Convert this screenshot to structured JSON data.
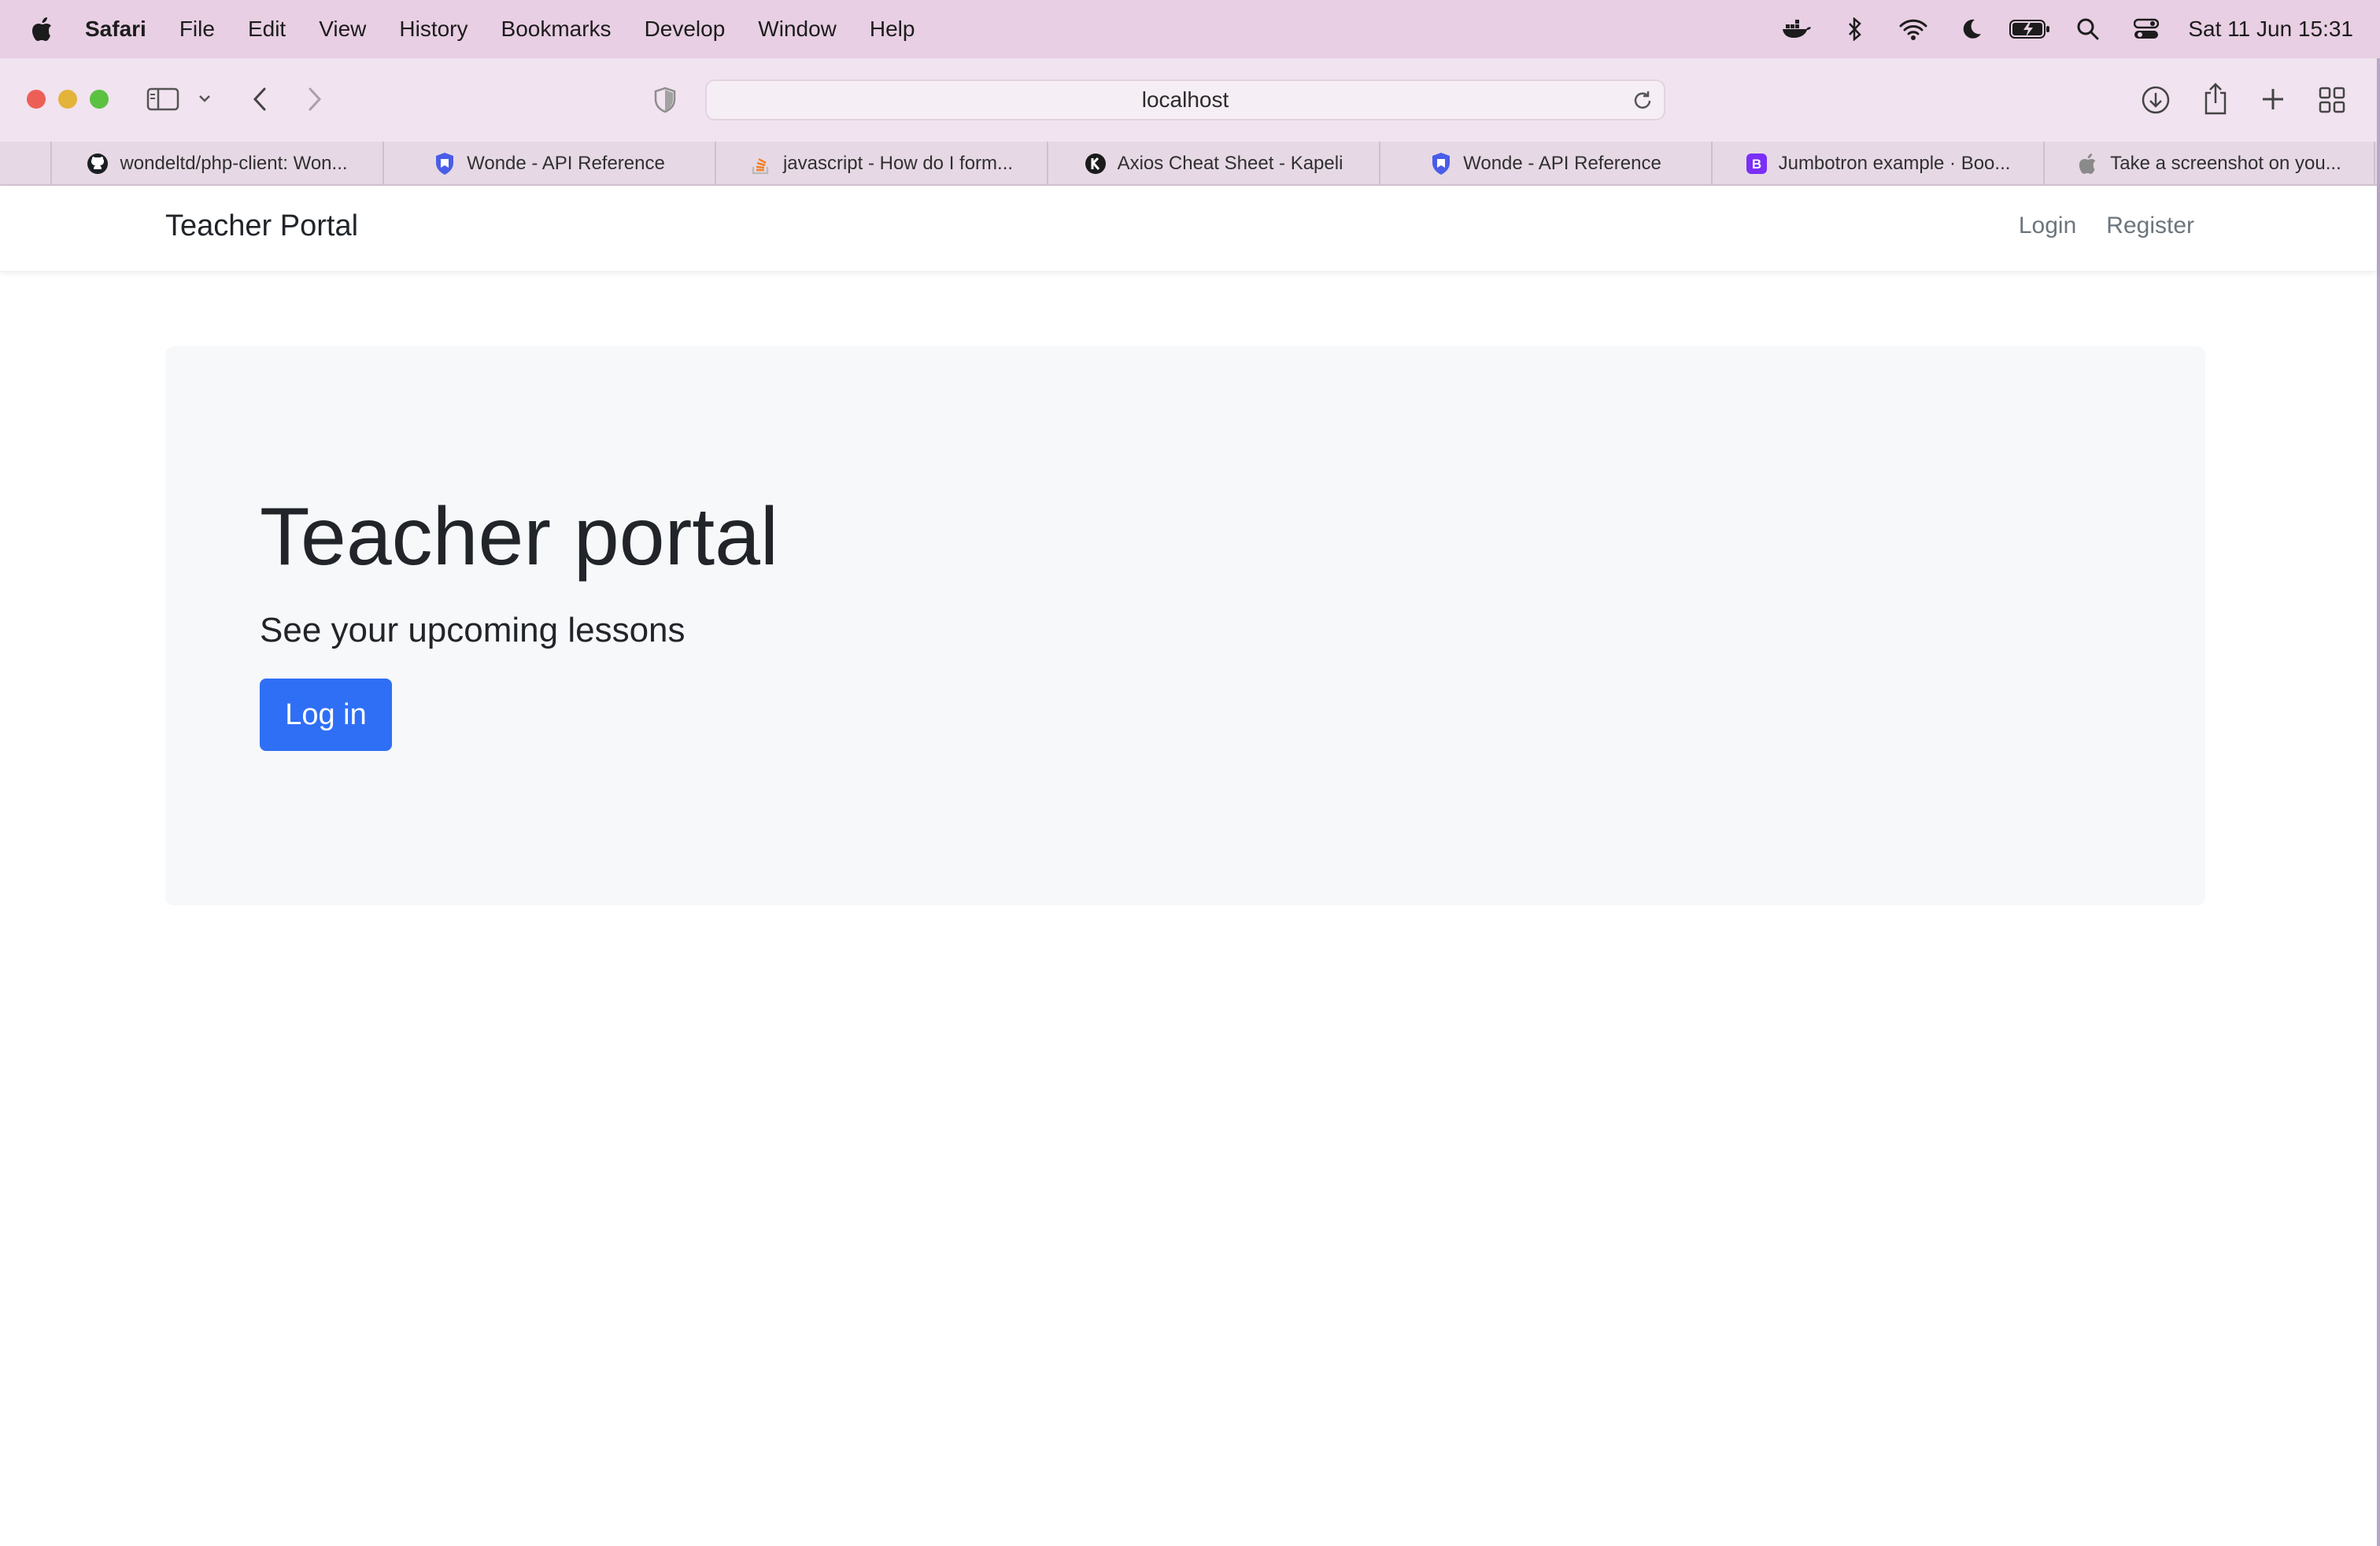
{
  "menubar": {
    "items": [
      "Safari",
      "File",
      "Edit",
      "View",
      "History",
      "Bookmarks",
      "Develop",
      "Window",
      "Help"
    ],
    "clock": "Sat 11 Jun  15:31",
    "status_icons": [
      "docker-icon",
      "bluetooth-icon",
      "wifi-icon",
      "moon-icon",
      "battery-icon",
      "spotlight-icon",
      "control-center-icon"
    ]
  },
  "browser": {
    "address": "localhost",
    "tabs": [
      {
        "label": "wondeltd/php-client: Won...",
        "icon": "github-icon"
      },
      {
        "label": "Wonde - API Reference",
        "icon": "shield-icon"
      },
      {
        "label": "javascript - How do I form...",
        "icon": "stackoverflow-icon"
      },
      {
        "label": "Axios Cheat Sheet - Kapeli",
        "icon": "kapeli-icon"
      },
      {
        "label": "Wonde - API Reference",
        "icon": "shield-icon"
      },
      {
        "label": "Jumbotron example · Boo...",
        "icon": "bootstrap-icon"
      },
      {
        "label": "Take a screenshot on you...",
        "icon": "apple-icon"
      }
    ]
  },
  "page": {
    "brand": "Teacher Portal",
    "nav": {
      "login": "Login",
      "register": "Register"
    },
    "jumbotron": {
      "title": "Teacher portal",
      "subtitle": "See your upcoming lessons",
      "button": "Log in"
    }
  },
  "colors": {
    "menubar_bg": "#e8cfe3",
    "toolbar_bg": "#f1e3ef",
    "primary_button": "#2f6ff5",
    "jumbotron_bg": "#f7f8fa"
  }
}
